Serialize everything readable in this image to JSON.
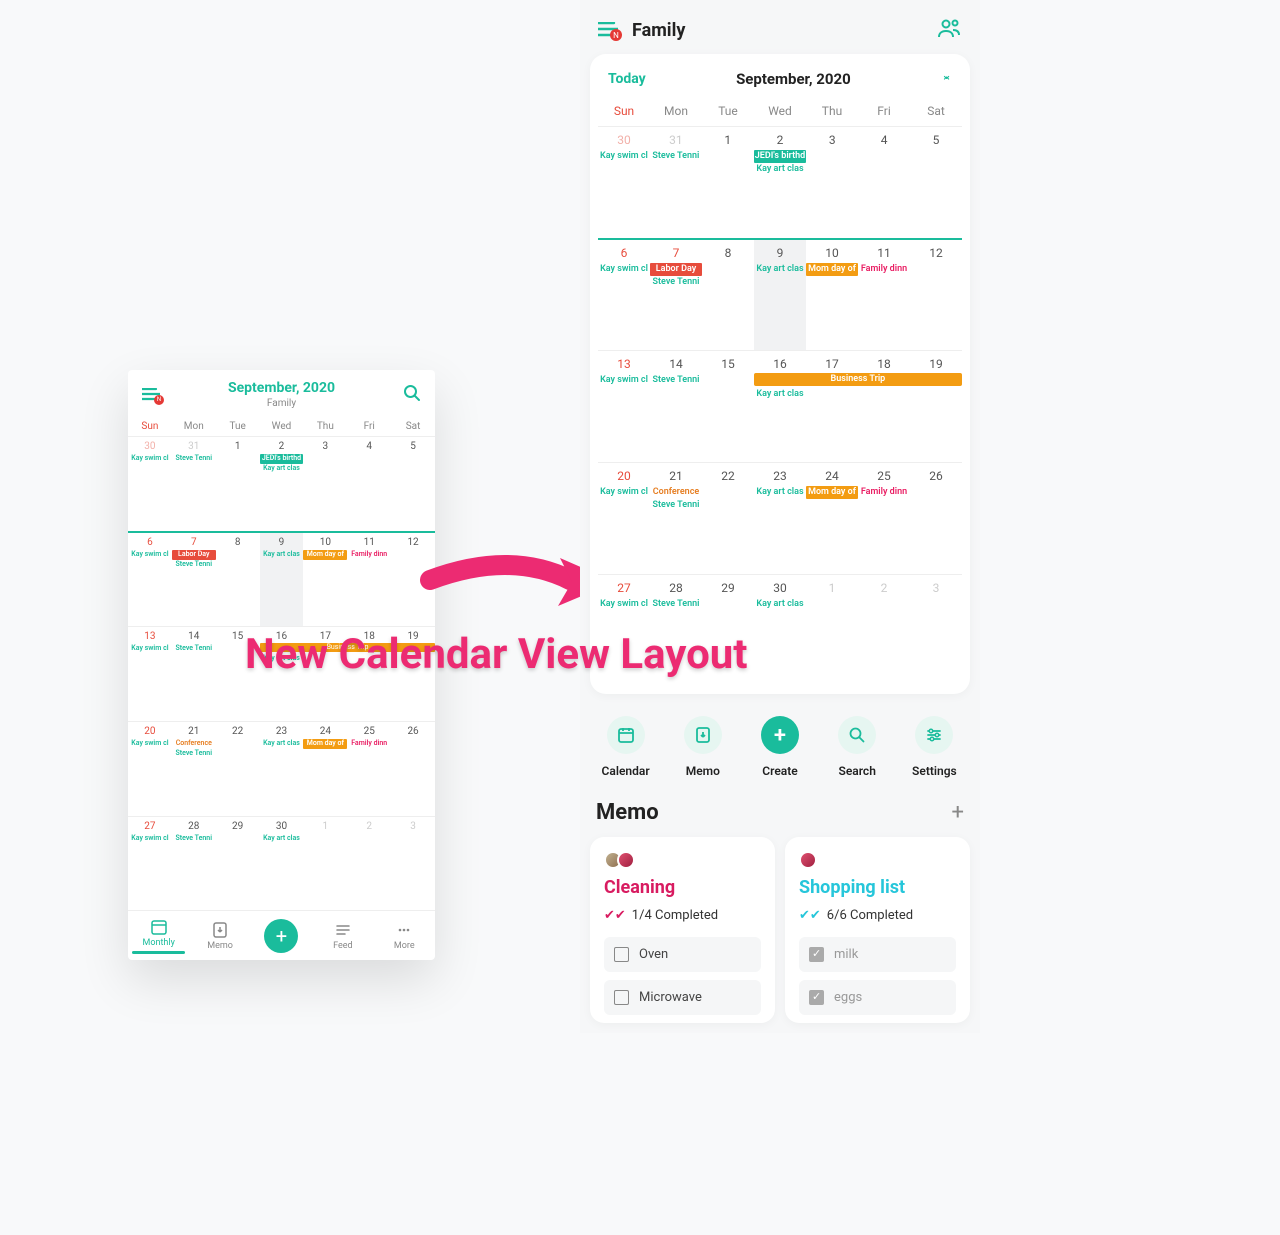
{
  "caption": "New Calendar View Layout",
  "left": {
    "month": "September, 2020",
    "family": "Family",
    "hamburger_badge": "N",
    "dow": [
      "Sun",
      "Mon",
      "Tue",
      "Wed",
      "Thu",
      "Fri",
      "Sat"
    ],
    "weeks": [
      {
        "days": [
          "30",
          "31",
          "1",
          "2",
          "3",
          "4",
          "5"
        ]
      },
      {
        "days": [
          "6",
          "7",
          "8",
          "9",
          "10",
          "11",
          "12"
        ]
      },
      {
        "days": [
          "13",
          "14",
          "15",
          "16",
          "17",
          "18",
          "19"
        ]
      },
      {
        "days": [
          "20",
          "21",
          "22",
          "23",
          "24",
          "25",
          "26"
        ]
      },
      {
        "days": [
          "27",
          "28",
          "29",
          "30",
          "1",
          "2",
          "3"
        ]
      }
    ],
    "events": {
      "kay_swim": "Kay swim cl",
      "steve_tennis": "Steve Tenni",
      "jedi_birth": "JEDI's birthd",
      "kay_art": "Kay art clas",
      "labor_day": "Labor Day",
      "mom_day": "Mom day of",
      "family_dinn": "Family dinn",
      "conference": "Conference",
      "business_trip": "Business Trip"
    },
    "tabs": {
      "monthly": "Monthly",
      "memo": "Memo",
      "feed": "Feed",
      "more": "More"
    }
  },
  "right": {
    "title": "Family",
    "today_label": "Today",
    "month": "September, 2020",
    "dow": [
      "Sun",
      "Mon",
      "Tue",
      "Wed",
      "Thu",
      "Fri",
      "Sat"
    ],
    "weeks": [
      {
        "days": [
          "30",
          "31",
          "1",
          "2",
          "3",
          "4",
          "5"
        ]
      },
      {
        "days": [
          "6",
          "7",
          "8",
          "9",
          "10",
          "11",
          "12"
        ]
      },
      {
        "days": [
          "13",
          "14",
          "15",
          "16",
          "17",
          "18",
          "19"
        ]
      },
      {
        "days": [
          "20",
          "21",
          "22",
          "23",
          "24",
          "25",
          "26"
        ]
      },
      {
        "days": [
          "27",
          "28",
          "29",
          "30",
          "1",
          "2",
          "3"
        ]
      }
    ],
    "events": {
      "kay_swim": "Kay swim cl",
      "steve_tennis": "Steve Tenni",
      "jedi_birth": "JEDI's birthd",
      "kay_art": "Kay art clas",
      "labor_day": "Labor Day",
      "mom_day": "Mom day of",
      "family_dinn": "Family dinn",
      "conference": "Conference",
      "business_trip": "Business Trip"
    },
    "actions": {
      "calendar": "Calendar",
      "memo": "Memo",
      "create": "Create",
      "search": "Search",
      "settings": "Settings"
    },
    "memo_header": "Memo",
    "memos": {
      "cleaning": {
        "title": "Cleaning",
        "progress": "1/4 Completed",
        "items": [
          {
            "label": "Oven",
            "done": false
          },
          {
            "label": "Microwave",
            "done": false
          }
        ]
      },
      "shopping": {
        "title": "Shopping list",
        "progress": "6/6 Completed",
        "items": [
          {
            "label": "milk",
            "done": true
          },
          {
            "label": "eggs",
            "done": true
          }
        ]
      }
    }
  }
}
